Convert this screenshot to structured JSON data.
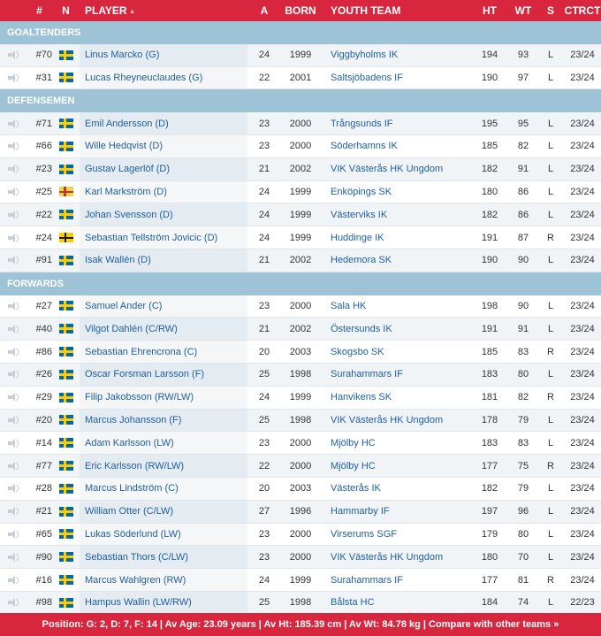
{
  "headers": {
    "num": "#",
    "n": "N",
    "player": "PLAYER",
    "a": "A",
    "born": "BORN",
    "team": "YOUTH TEAM",
    "ht": "HT",
    "wt": "WT",
    "s": "S",
    "ctrct": "CTRCT"
  },
  "sections": [
    {
      "title": "GOALTENDERS",
      "players": [
        {
          "num": "#70",
          "name": "Linus Marcko (G)",
          "a": "24",
          "born": "1999",
          "team": "Viggbyholms IK",
          "ht": "194",
          "wt": "93",
          "s": "L",
          "ctrct": "23/24",
          "flag": "sweden"
        },
        {
          "num": "#31",
          "name": "Lucas Rheyneuclaudes (G)",
          "a": "22",
          "born": "2001",
          "team": "Saltsjöbadens IF",
          "ht": "190",
          "wt": "97",
          "s": "L",
          "ctrct": "23/24",
          "flag": "sweden"
        }
      ]
    },
    {
      "title": "DEFENSEMEN",
      "players": [
        {
          "num": "#71",
          "name": "Emil Andersson (D)",
          "a": "23",
          "born": "2000",
          "team": "Trångsunds IF",
          "ht": "195",
          "wt": "95",
          "s": "L",
          "ctrct": "23/24",
          "flag": "sweden"
        },
        {
          "num": "#66",
          "name": "Wille Hedqvist (D)",
          "a": "23",
          "born": "2000",
          "team": "Söderhamns IK",
          "ht": "185",
          "wt": "82",
          "s": "L",
          "ctrct": "23/24",
          "flag": "sweden"
        },
        {
          "num": "#23",
          "name": "Gustav Lagerlöf (D)",
          "a": "21",
          "born": "2002",
          "team": "VIK Västerås HK Ungdom",
          "ht": "182",
          "wt": "91",
          "s": "L",
          "ctrct": "23/24",
          "flag": "sweden"
        },
        {
          "num": "#25",
          "name": "Karl Markström (D)",
          "a": "24",
          "born": "1999",
          "team": "Enköpings SK",
          "ht": "180",
          "wt": "86",
          "s": "L",
          "ctrct": "23/24",
          "flag": "other-1"
        },
        {
          "num": "#22",
          "name": "Johan Svensson (D)",
          "a": "24",
          "born": "1999",
          "team": "Västerviks IK",
          "ht": "182",
          "wt": "86",
          "s": "L",
          "ctrct": "23/24",
          "flag": "sweden"
        },
        {
          "num": "#24",
          "name": "Sebastian Tellström Jovicic (D)",
          "a": "24",
          "born": "1999",
          "team": "Huddinge IK",
          "ht": "191",
          "wt": "87",
          "s": "R",
          "ctrct": "23/24",
          "flag": "other-2"
        },
        {
          "num": "#91",
          "name": "Isak Wallén (D)",
          "a": "21",
          "born": "2002",
          "team": "Hedemora SK",
          "ht": "190",
          "wt": "90",
          "s": "L",
          "ctrct": "23/24",
          "flag": "sweden"
        }
      ]
    },
    {
      "title": "FORWARDS",
      "players": [
        {
          "num": "#27",
          "name": "Samuel Ander (C)",
          "a": "23",
          "born": "2000",
          "team": "Sala HK",
          "ht": "198",
          "wt": "90",
          "s": "L",
          "ctrct": "23/24",
          "flag": "sweden"
        },
        {
          "num": "#40",
          "name": "Vilgot Dahlén (C/RW)",
          "a": "21",
          "born": "2002",
          "team": "Östersunds IK",
          "ht": "191",
          "wt": "91",
          "s": "L",
          "ctrct": "23/24",
          "flag": "sweden"
        },
        {
          "num": "#86",
          "name": "Sebastian Ehrencrona (C)",
          "a": "20",
          "born": "2003",
          "team": "Skogsbo SK",
          "ht": "185",
          "wt": "83",
          "s": "R",
          "ctrct": "23/24",
          "flag": "sweden"
        },
        {
          "num": "#26",
          "name": "Oscar Forsman Larsson (F)",
          "a": "25",
          "born": "1998",
          "team": "Surahammars IF",
          "ht": "183",
          "wt": "80",
          "s": "L",
          "ctrct": "23/24",
          "flag": "sweden"
        },
        {
          "num": "#29",
          "name": "Filip Jakobsson (RW/LW)",
          "a": "24",
          "born": "1999",
          "team": "Hanvikens SK",
          "ht": "181",
          "wt": "82",
          "s": "R",
          "ctrct": "23/24",
          "flag": "sweden"
        },
        {
          "num": "#20",
          "name": "Marcus Johansson (F)",
          "a": "25",
          "born": "1998",
          "team": "VIK Västerås HK Ungdom",
          "ht": "178",
          "wt": "79",
          "s": "L",
          "ctrct": "23/24",
          "flag": "sweden"
        },
        {
          "num": "#14",
          "name": "Adam Karlsson (LW)",
          "a": "23",
          "born": "2000",
          "team": "Mjölby HC",
          "ht": "183",
          "wt": "83",
          "s": "L",
          "ctrct": "23/24",
          "flag": "sweden"
        },
        {
          "num": "#77",
          "name": "Eric Karlsson (RW/LW)",
          "a": "22",
          "born": "2000",
          "team": "Mjölby HC",
          "ht": "177",
          "wt": "75",
          "s": "R",
          "ctrct": "23/24",
          "flag": "sweden"
        },
        {
          "num": "#28",
          "name": "Marcus Lindström (C)",
          "a": "20",
          "born": "2003",
          "team": "Västerås IK",
          "ht": "182",
          "wt": "79",
          "s": "L",
          "ctrct": "23/24",
          "flag": "sweden"
        },
        {
          "num": "#21",
          "name": "William Otter (C/LW)",
          "a": "27",
          "born": "1996",
          "team": "Hammarby IF",
          "ht": "197",
          "wt": "96",
          "s": "L",
          "ctrct": "23/24",
          "flag": "sweden"
        },
        {
          "num": "#65",
          "name": "Lukas Söderlund (LW)",
          "a": "23",
          "born": "2000",
          "team": "Virserums SGF",
          "ht": "179",
          "wt": "80",
          "s": "L",
          "ctrct": "23/24",
          "flag": "sweden"
        },
        {
          "num": "#90",
          "name": "Sebastian Thors (C/LW)",
          "a": "23",
          "born": "2000",
          "team": "VIK Västerås HK Ungdom",
          "ht": "180",
          "wt": "70",
          "s": "L",
          "ctrct": "23/24",
          "flag": "sweden"
        },
        {
          "num": "#16",
          "name": "Marcus Wahlgren (RW)",
          "a": "24",
          "born": "1999",
          "team": "Surahammars IF",
          "ht": "177",
          "wt": "81",
          "s": "R",
          "ctrct": "23/24",
          "flag": "sweden"
        },
        {
          "num": "#98",
          "name": "Hampus Wallin (LW/RW)",
          "a": "25",
          "born": "1998",
          "team": "Bålsta HC",
          "ht": "184",
          "wt": "74",
          "s": "L",
          "ctrct": "22/23",
          "flag": "sweden"
        }
      ]
    }
  ],
  "footer": {
    "summary": "Position: G: 2, D: 7, F: 14 | Av Age: 23.09 years | Av Ht: 185.39 cm | Av Wt: 84.78 kg | ",
    "compare_link": "Compare with other teams »"
  },
  "colors": {
    "accent": "#d7263d",
    "section": "#9fc3d6",
    "link": "#1f5fa0"
  }
}
